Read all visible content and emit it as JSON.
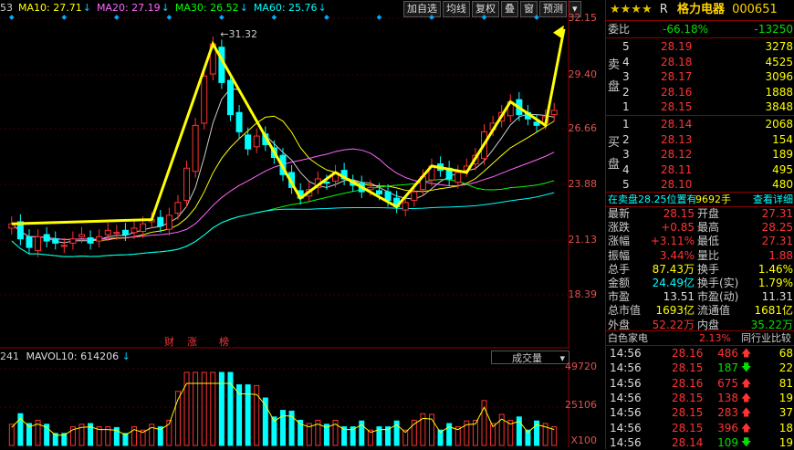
{
  "ma_legend": [
    {
      "label": "53",
      "color": "#cccccc"
    },
    {
      "label": "MA10: 27.71",
      "color": "#ffff00"
    },
    {
      "label": "MA20: 27.19",
      "color": "#ff66ff"
    },
    {
      "label": "MA30: 26.52",
      "color": "#00ff00"
    },
    {
      "label": "MA60: 25.76",
      "color": "#00ffff"
    }
  ],
  "toolbar": [
    "加自选",
    "均线",
    "复权",
    "叠",
    "窗",
    "预测",
    "▾"
  ],
  "price_scale": [
    "32.15",
    "29.40",
    "26.66",
    "23.88",
    "21.13",
    "18.39"
  ],
  "peak_label": "31.32",
  "event_labels": [
    "财",
    "涨",
    "榜"
  ],
  "vol_legend": {
    "prefix": "241",
    "mavol10": "MAVOL10: 614206"
  },
  "vol_select": "成交量",
  "vol_scale": [
    "49720",
    "25106",
    "X100"
  ],
  "chart_data": {
    "type": "candlestick",
    "ylim": [
      17.5,
      32.5
    ],
    "close": [
      22.9,
      22.2,
      21.8,
      22.3,
      22.1,
      22.0,
      21.9,
      22.2,
      22.4,
      22.0,
      22.3,
      22.6,
      22.5,
      22.4,
      22.7,
      22.9,
      23.1,
      22.8,
      23.3,
      23.9,
      25.5,
      27.5,
      29.8,
      31.3,
      29.5,
      28.0,
      27.2,
      26.4,
      27.0,
      26.6,
      26.0,
      25.2,
      24.6,
      24.1,
      24.5,
      25.0,
      24.8,
      25.3,
      25.0,
      24.7,
      24.4,
      24.6,
      24.3,
      24.0,
      23.7,
      23.9,
      24.4,
      25.1,
      25.6,
      25.4,
      25.0,
      25.3,
      25.6,
      26.1,
      27.2,
      27.6,
      28.1,
      28.6,
      28.0,
      27.8,
      27.5,
      27.9,
      28.2
    ],
    "volume_scale_max": 49720
  },
  "stock": {
    "stars": "★★★★",
    "prefix": "R",
    "name": "格力电器",
    "code": "000651"
  },
  "webi": {
    "label": "委比",
    "ratio": "-66.18%",
    "diff": "-13250"
  },
  "sell_side_label": [
    "卖",
    "盘"
  ],
  "buy_side_label": [
    "买",
    "盘"
  ],
  "sell": [
    {
      "level": "5",
      "price": "28.19",
      "vol": "3278"
    },
    {
      "level": "4",
      "price": "28.18",
      "vol": "4525"
    },
    {
      "level": "3",
      "price": "28.17",
      "vol": "3096"
    },
    {
      "level": "2",
      "price": "28.16",
      "vol": "1888"
    },
    {
      "level": "1",
      "price": "28.15",
      "vol": "3848"
    }
  ],
  "buy": [
    {
      "level": "1",
      "price": "28.14",
      "vol": "2068"
    },
    {
      "level": "2",
      "price": "28.13",
      "vol": "154"
    },
    {
      "level": "3",
      "price": "28.12",
      "vol": "189"
    },
    {
      "level": "4",
      "price": "28.11",
      "vol": "495"
    },
    {
      "level": "5",
      "price": "28.10",
      "vol": "480"
    }
  ],
  "bar_info": {
    "text": "在卖盘28.25位置有",
    "vol": "9692手",
    "link": "查看详细"
  },
  "stats": [
    {
      "l1": "最新",
      "v1": "28.15",
      "c1": "red",
      "l2": "开盘",
      "v2": "27.31",
      "c2": "red"
    },
    {
      "l1": "涨跌",
      "v1": "+0.85",
      "c1": "red",
      "l2": "最高",
      "v2": "28.25",
      "c2": "red"
    },
    {
      "l1": "涨幅",
      "v1": "+3.11%",
      "c1": "red",
      "l2": "最低",
      "v2": "27.31",
      "c2": "red"
    },
    {
      "l1": "振幅",
      "v1": "3.44%",
      "c1": "red",
      "l2": "量比",
      "v2": "1.88",
      "c2": "red"
    },
    {
      "l1": "总手",
      "v1": "87.43万",
      "c1": "yellow",
      "l2": "换手",
      "v2": "1.46%",
      "c2": "yellow"
    },
    {
      "l1": "金额",
      "v1": "24.49亿",
      "c1": "cyan",
      "l2": "换手(实)",
      "v2": "1.79%",
      "c2": "yellow"
    },
    {
      "l1": "市盈",
      "v1": "13.51",
      "c1": "white",
      "l2": "市盈(动)",
      "v2": "11.31",
      "c2": "white"
    },
    {
      "l1": "总市值",
      "v1": "1693亿",
      "c1": "yellow",
      "l2": "流通值",
      "v2": "1681亿",
      "c2": "yellow"
    },
    {
      "l1": "外盘",
      "v1": "52.22万",
      "c1": "red",
      "l2": "内盘",
      "v2": "35.22万",
      "c2": "green"
    }
  ],
  "industry": {
    "name": "白色家电",
    "pct": "2.13%",
    "compare": "同行业比较"
  },
  "trades": [
    {
      "time": "14:56",
      "price": "28.16",
      "vol": "486",
      "dir": "up",
      "n": "68"
    },
    {
      "time": "14:56",
      "price": "28.15",
      "vol": "187",
      "dir": "down",
      "n": "22"
    },
    {
      "time": "14:56",
      "price": "28.16",
      "vol": "675",
      "dir": "up",
      "n": "81"
    },
    {
      "time": "14:56",
      "price": "28.15",
      "vol": "138",
      "dir": "up",
      "n": "19"
    },
    {
      "time": "14:56",
      "price": "28.15",
      "vol": "283",
      "dir": "up",
      "n": "37"
    },
    {
      "time": "14:56",
      "price": "28.15",
      "vol": "396",
      "dir": "up",
      "n": "18"
    },
    {
      "time": "14:56",
      "price": "28.14",
      "vol": "109",
      "dir": "down",
      "n": "19"
    }
  ]
}
